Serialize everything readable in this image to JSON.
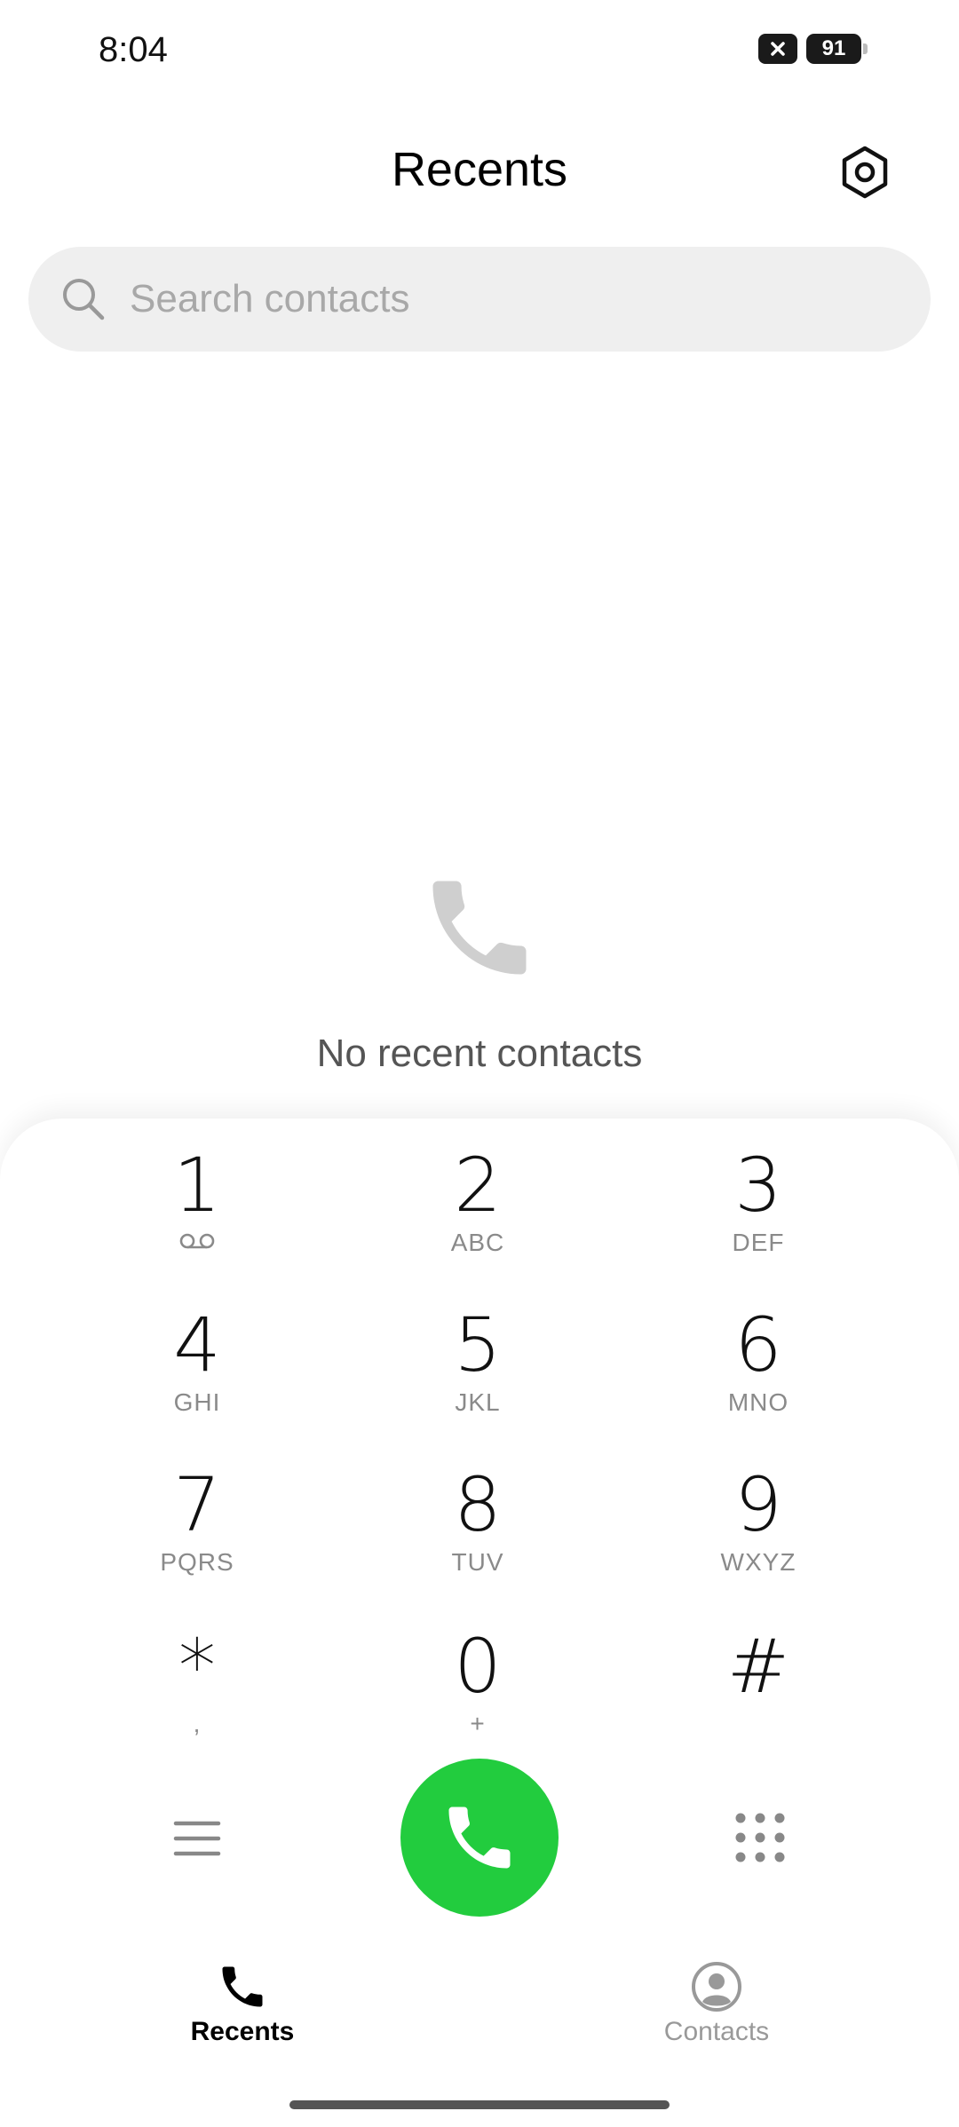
{
  "status_bar": {
    "time": "8:04",
    "battery_level": "91",
    "sim_icon": "no-sim-icon"
  },
  "header": {
    "title": "Recents",
    "settings_icon": "settings-gear-icon"
  },
  "search": {
    "placeholder": "Search contacts"
  },
  "empty_state": {
    "icon": "phone-icon",
    "message": "No recent contacts"
  },
  "dialpad": {
    "keys": [
      {
        "digit": "1",
        "letters": "",
        "sub_icon": "voicemail-icon"
      },
      {
        "digit": "2",
        "letters": "ABC"
      },
      {
        "digit": "3",
        "letters": "DEF"
      },
      {
        "digit": "4",
        "letters": "GHI"
      },
      {
        "digit": "5",
        "letters": "JKL"
      },
      {
        "digit": "6",
        "letters": "MNO"
      },
      {
        "digit": "7",
        "letters": "PQRS"
      },
      {
        "digit": "8",
        "letters": "TUV"
      },
      {
        "digit": "9",
        "letters": "WXYZ"
      },
      {
        "digit": "*",
        "letters": ","
      },
      {
        "digit": "0",
        "letters": "+"
      },
      {
        "digit": "#",
        "letters": ""
      }
    ],
    "call_color": "#22cc3e"
  },
  "bottom_nav": {
    "items": [
      {
        "label": "Recents",
        "active": true
      },
      {
        "label": "Contacts",
        "active": false
      }
    ]
  }
}
